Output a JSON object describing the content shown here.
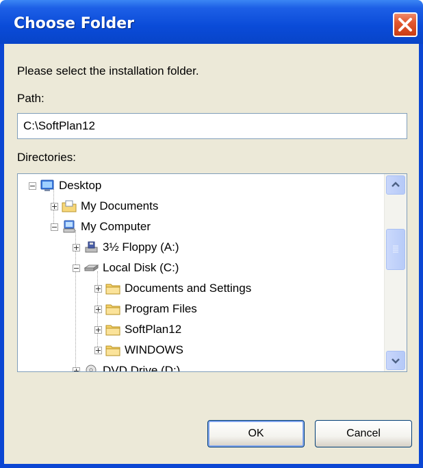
{
  "window": {
    "title": "Choose Folder"
  },
  "dialog": {
    "instruction": "Please select the installation folder.",
    "path_label": "Path:",
    "path_value": "C:\\SoftPlan12",
    "directories_label": "Directories:"
  },
  "tree": {
    "items": [
      {
        "label": "Desktop",
        "icon": "desktop-icon",
        "expander": "minus"
      },
      {
        "label": "My Documents",
        "icon": "my-documents-folder-icon",
        "expander": "plus"
      },
      {
        "label": "My Computer",
        "icon": "my-computer-icon",
        "expander": "minus"
      },
      {
        "label": "3½ Floppy (A:)",
        "icon": "floppy-drive-icon",
        "expander": "plus"
      },
      {
        "label": "Local Disk (C:)",
        "icon": "hard-disk-icon",
        "expander": "minus"
      },
      {
        "label": "Documents and Settings",
        "icon": "folder-icon",
        "expander": "plus"
      },
      {
        "label": "Program Files",
        "icon": "folder-icon",
        "expander": "plus"
      },
      {
        "label": "SoftPlan12",
        "icon": "folder-icon",
        "expander": "plus"
      },
      {
        "label": "WINDOWS",
        "icon": "folder-icon",
        "expander": "plus"
      },
      {
        "label": "DVD Drive (D:)",
        "icon": "dvd-drive-icon",
        "expander": "plus"
      }
    ]
  },
  "buttons": {
    "ok": "OK",
    "cancel": "Cancel"
  },
  "colors": {
    "titlebar": "#0a4bd8",
    "close_button": "#e2572f",
    "client_background": "#ece9d8",
    "field_border": "#7f9db9"
  }
}
